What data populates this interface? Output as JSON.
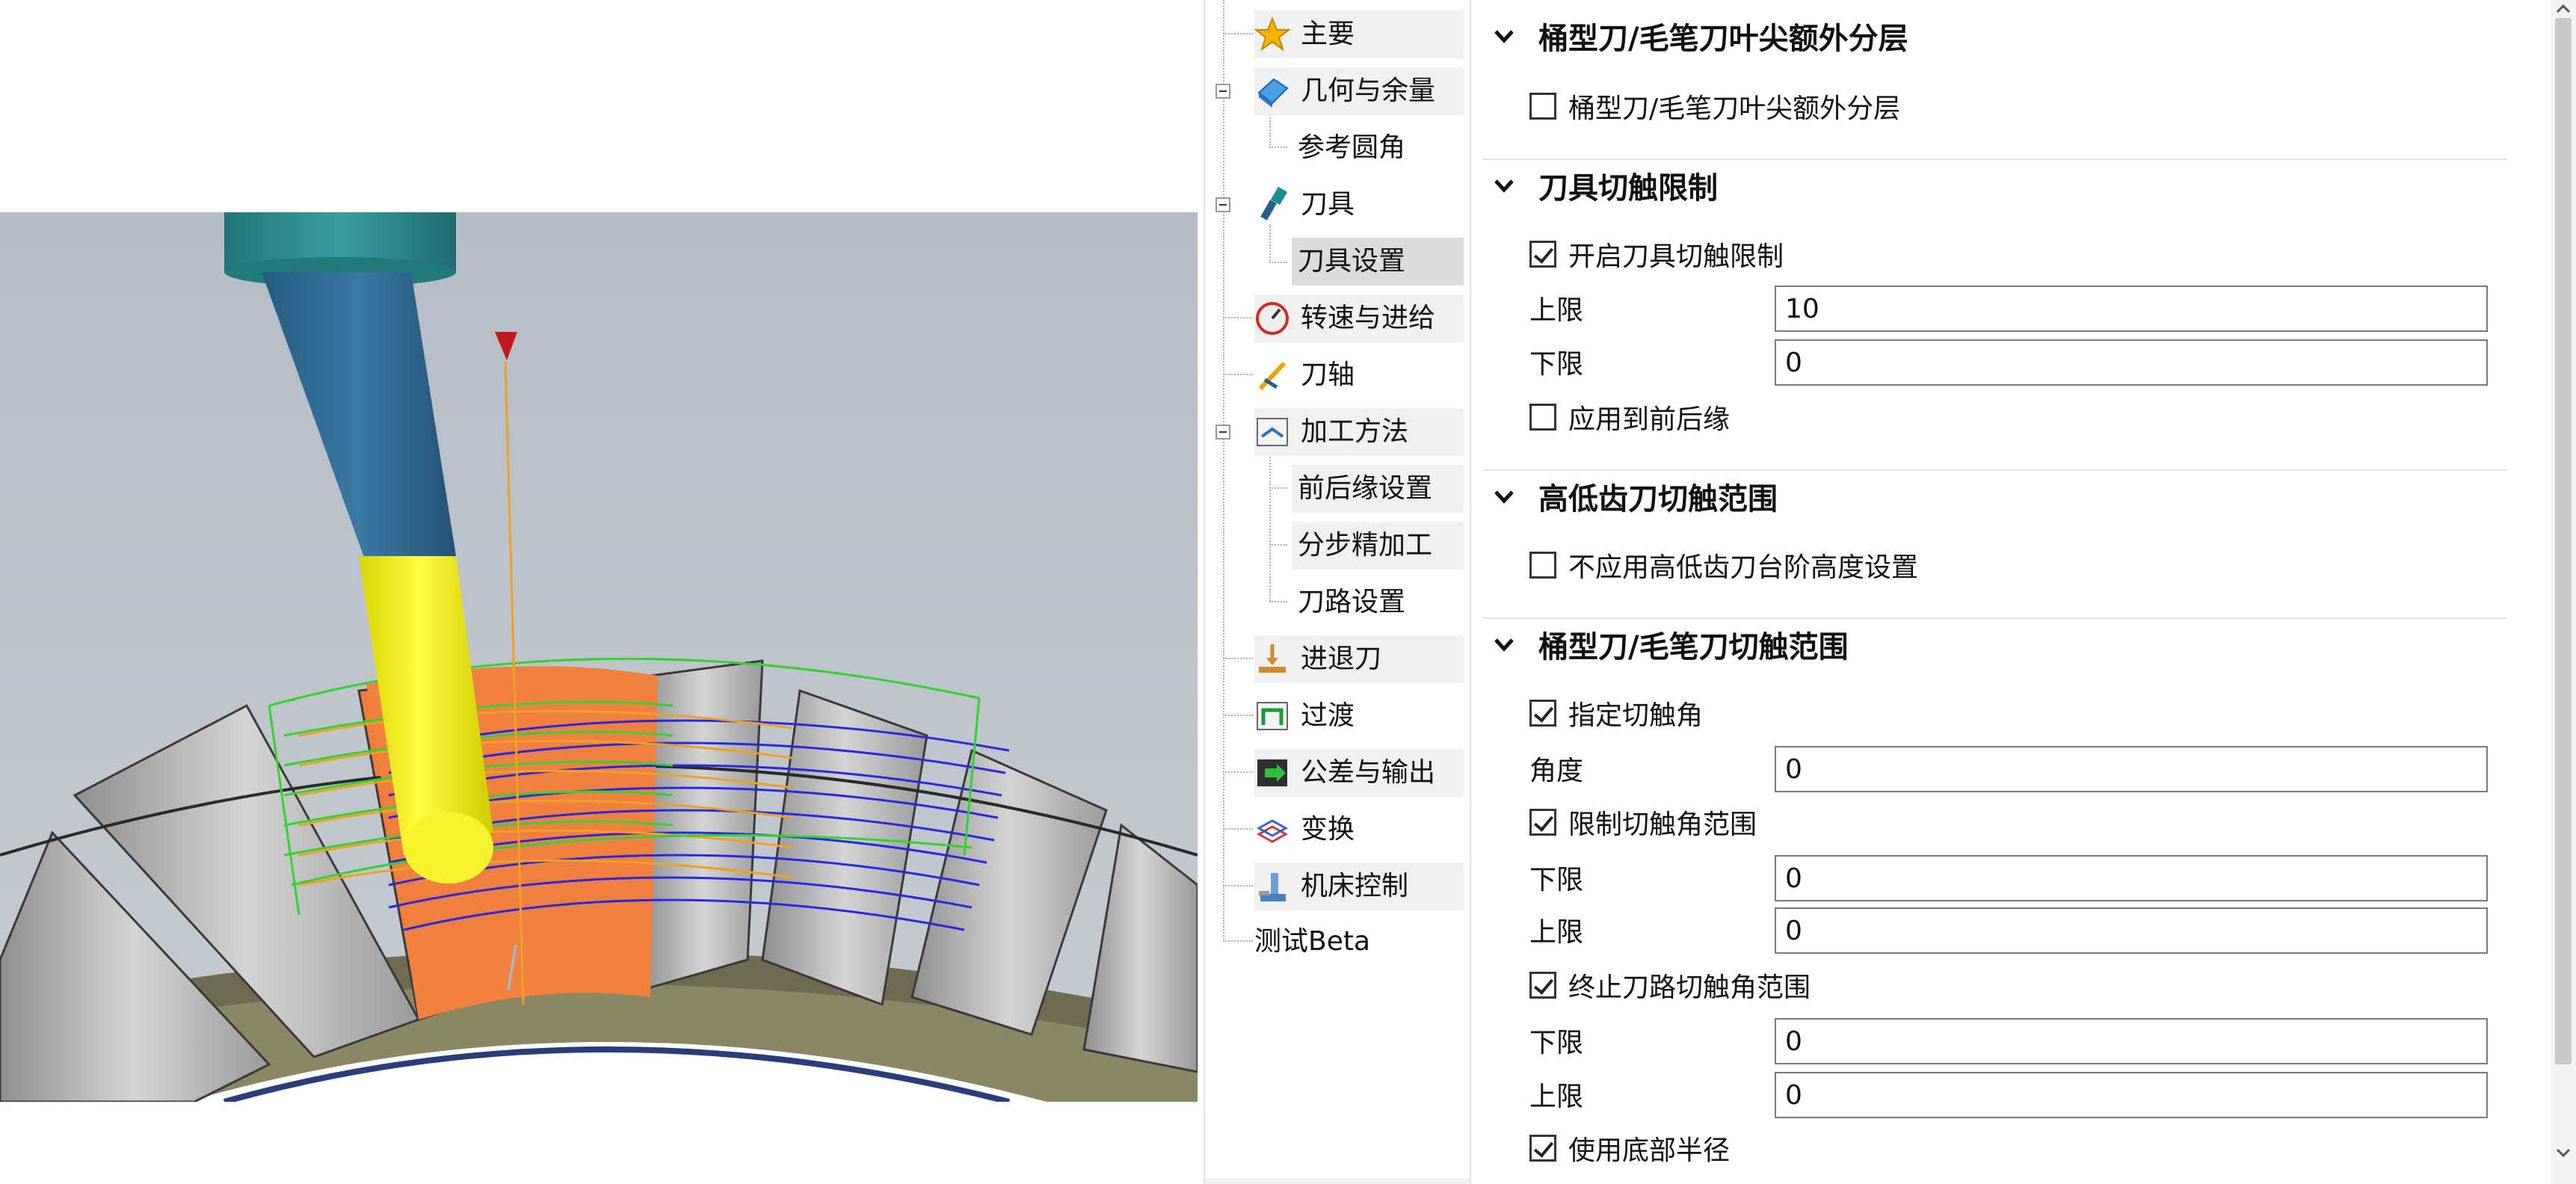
{
  "tree": {
    "items": [
      {
        "label": "主要",
        "icon": "star-icon"
      },
      {
        "label": "几何与余量",
        "icon": "geometry-icon"
      },
      {
        "label": "参考圆角",
        "icon": ""
      },
      {
        "label": "刀具",
        "icon": "tool-icon"
      },
      {
        "label": "刀具设置",
        "icon": ""
      },
      {
        "label": "转速与进给",
        "icon": "speed-feed-icon"
      },
      {
        "label": "刀轴",
        "icon": "tool-axis-icon"
      },
      {
        "label": "加工方法",
        "icon": "machining-method-icon"
      },
      {
        "label": "前后缘设置",
        "icon": ""
      },
      {
        "label": "分步精加工",
        "icon": ""
      },
      {
        "label": "刀路设置",
        "icon": ""
      },
      {
        "label": "进退刀",
        "icon": "lead-in-out-icon"
      },
      {
        "label": "过渡",
        "icon": "transition-icon"
      },
      {
        "label": "公差与输出",
        "icon": "tolerance-output-icon"
      },
      {
        "label": "变换",
        "icon": "transform-icon"
      },
      {
        "label": "机床控制",
        "icon": "machine-control-icon"
      },
      {
        "label": "测试Beta",
        "icon": ""
      }
    ],
    "selected": "刀具设置"
  },
  "sections": {
    "barrel_tip_layer": {
      "title": "桶型刀/毛笔刀叶尖额外分层",
      "checkbox_label": "桶型刀/毛笔刀叶尖额外分层",
      "checked": false
    },
    "tool_contact_limit": {
      "title": "刀具切触限制",
      "enable_label": "开启刀具切触限制",
      "enable_checked": true,
      "upper_label": "上限",
      "upper_value": "10",
      "lower_label": "下限",
      "lower_value": "0",
      "apply_edges_label": "应用到前后缘",
      "apply_edges_checked": false
    },
    "step_tool_range": {
      "title": "高低齿刀切触范围",
      "checkbox_label": "不应用高低齿刀台阶高度设置",
      "checked": false
    },
    "barrel_contact_range": {
      "title": "桶型刀/毛笔刀切触范围",
      "specify_angle_label": "指定切触角",
      "specify_angle_checked": true,
      "angle_label": "角度",
      "angle_value": "0",
      "limit_range_label": "限制切触角范围",
      "limit_range_checked": true,
      "limit_lower_label": "下限",
      "limit_lower_value": "0",
      "limit_upper_label": "上限",
      "limit_upper_value": "0",
      "stop_range_label": "终止刀路切触角范围",
      "stop_range_checked": true,
      "stop_lower_label": "下限",
      "stop_lower_value": "0",
      "stop_upper_label": "上限",
      "stop_upper_value": "0",
      "bottom_radius_label": "使用底部半径",
      "bottom_radius_checked": true
    }
  },
  "colors": {
    "viewport_bg": "#b9bfc6",
    "tool_holder": "#2e8b8e",
    "tool_shank": "#2f6a93",
    "tool_tip": "#f3f01a",
    "blade_face": "#f08040",
    "toolpath_green": "#32d232",
    "toolpath_blue": "#2828e0",
    "toolpath_orange": "#f0a020"
  }
}
